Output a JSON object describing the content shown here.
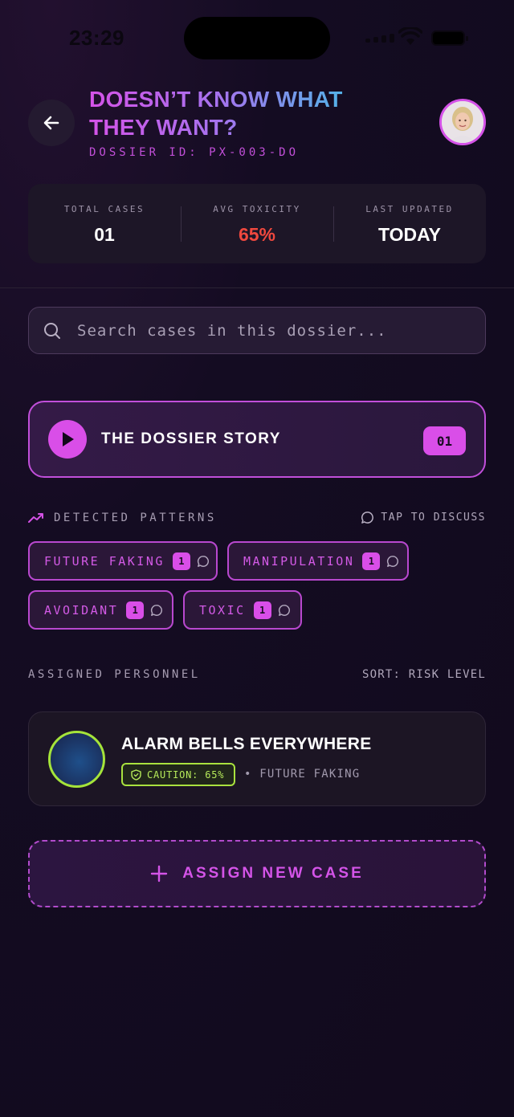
{
  "status_bar": {
    "time": "23:29"
  },
  "header": {
    "title": "DOESN’T KNOW WHAT THEY WANT?",
    "dossier_id": "DOSSIER ID: PX-003-DO"
  },
  "stats": [
    {
      "label": "TOTAL CASES",
      "value": "01"
    },
    {
      "label": "AVG TOXICITY",
      "value": "65%"
    },
    {
      "label": "LAST UPDATED",
      "value": "TODAY"
    }
  ],
  "search": {
    "placeholder": "Search cases in this dossier..."
  },
  "story": {
    "title": "THE DOSSIER STORY",
    "count": "01"
  },
  "patterns": {
    "heading": "DETECTED PATTERNS",
    "action": "TAP TO DISCUSS",
    "tags": [
      {
        "label": "FUTURE FAKING",
        "count": "1"
      },
      {
        "label": "MANIPULATION",
        "count": "1"
      },
      {
        "label": "AVOIDANT",
        "count": "1"
      },
      {
        "label": "TOXIC",
        "count": "1"
      }
    ]
  },
  "personnel": {
    "heading": "ASSIGNED PERSONNEL",
    "sort": "SORT: RISK LEVEL",
    "cases": [
      {
        "title": "ALARM BELLS EVERYWHERE",
        "caution": "CAUTION: 65%",
        "meta": "• FUTURE FAKING"
      }
    ]
  },
  "assign": {
    "label": "ASSIGN NEW CASE"
  },
  "colors": {
    "accent": "#d94ee8",
    "toxicity": "#f0483e",
    "caution": "#a9e23e",
    "background": "#140c22"
  }
}
